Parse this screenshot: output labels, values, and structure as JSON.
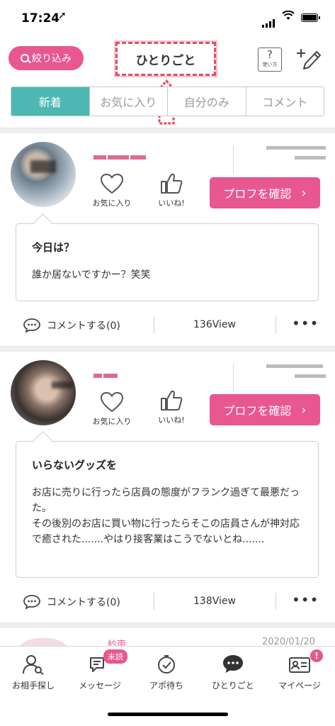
{
  "status_bar": {
    "time": "17:24",
    "location_icon": "location-arrow-icon"
  },
  "header": {
    "filter_label": "絞り込み",
    "title": "ひとりごと",
    "help_label": "使い方",
    "help_glyph": "?"
  },
  "tabs": [
    {
      "label": "新着",
      "active": true
    },
    {
      "label": "お気に入り",
      "active": false
    },
    {
      "label": "自分のみ",
      "active": false
    },
    {
      "label": "コメント",
      "active": false
    }
  ],
  "posts": [
    {
      "fav_label": "お気に入り",
      "like_label": "いいね!",
      "profile_button": "プロフを確認",
      "title": "今日は？",
      "body": "誰か居ないですかー？笑笑",
      "comment_label": "コメントする(0)",
      "views": "136View"
    },
    {
      "fav_label": "お気に入り",
      "like_label": "いいね!",
      "profile_button": "プロフを確認",
      "title": "いらないグッズを",
      "body": "お店に売りに行ったら店員の態度がフランク過ぎて最悪だった。\nその後別のお店に買い物に行ったらそこの店員さんが神対応で癒された.......やはり接客業はこうでないとね.......",
      "comment_label": "コメントする(0)",
      "views": "138View"
    },
    {
      "name": "紗南",
      "date": "2020/01/20"
    }
  ],
  "bottom_nav": [
    {
      "label": "お相手探し",
      "icon": "user-search-icon"
    },
    {
      "label": "メッセージ",
      "icon": "chat-bubbles-icon",
      "badge": "未読"
    },
    {
      "label": "アポ待ち",
      "icon": "appointment-icon"
    },
    {
      "label": "ひとりごと",
      "icon": "speech-bubble-icon"
    },
    {
      "label": "マイページ",
      "icon": "id-card-icon",
      "badge": "!"
    }
  ],
  "colors": {
    "accent_pink": "#e8578f",
    "tab_teal": "#4cb8b1",
    "annotation_red": "#e34a67"
  }
}
